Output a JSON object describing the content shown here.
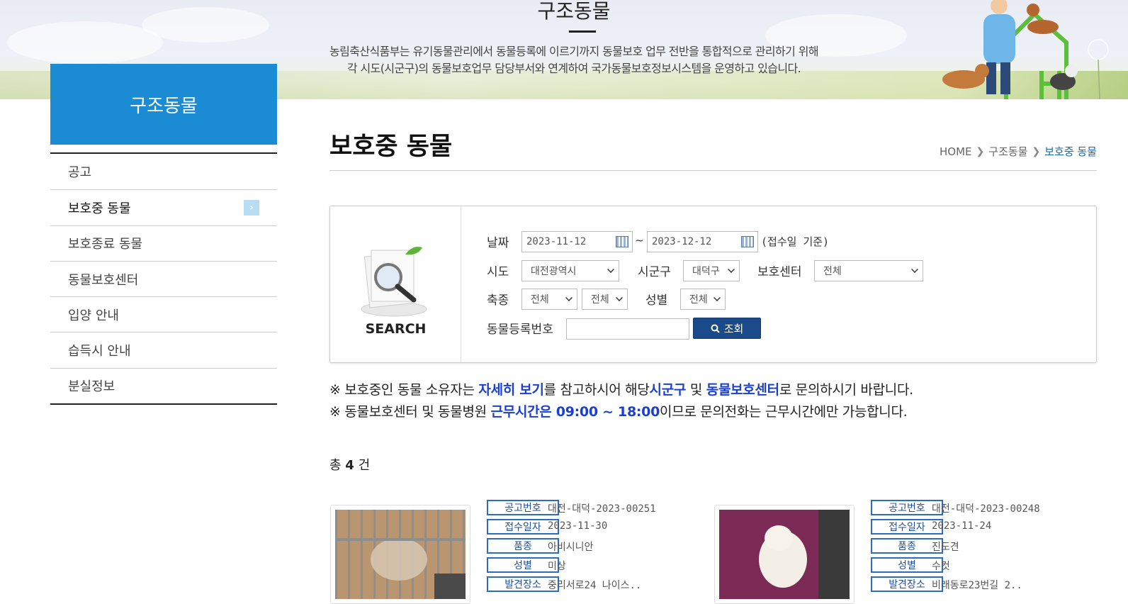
{
  "banner": {
    "title": "구조동물",
    "desc_line1": "농림축산식품부는 유기동물관리에서 동물등록에 이르기까지 동물보호 업무 전반을 통합적으로 관리하기 위해",
    "desc_line2": "각 시도(시군구)의 동물보호업무 담당부서와 연계하여 국가동물보호정보시스템을 운영하고 있습니다."
  },
  "sidebar": {
    "title": "구조동물",
    "items": [
      {
        "label": "공고"
      },
      {
        "label": "보호중 동물"
      },
      {
        "label": "보호종료 동물"
      },
      {
        "label": "동물보호센터"
      },
      {
        "label": "입양 안내"
      },
      {
        "label": "습득시 안내"
      },
      {
        "label": "분실정보"
      }
    ]
  },
  "page": {
    "title": "보호중 동물"
  },
  "breadcrumb": {
    "home": "HOME",
    "level1": "구조동물",
    "current": "보호중 동물"
  },
  "search": {
    "label": "SEARCH",
    "date_label": "날짜",
    "date_from": "2023-11-12",
    "date_to": "2023-12-12",
    "date_sep": "~",
    "date_note": "(접수일 기준)",
    "sido_label": "시도",
    "sido_value": "대전광역시",
    "sigungu_label": "시군구",
    "sigungu_value": "대덕구",
    "center_label": "보호센터",
    "center_value": "전체",
    "species_label": "축종",
    "species_value": "전체",
    "breed_value": "전체",
    "sex_label": "성별",
    "sex_value": "전체",
    "reg_label": "동물등록번호",
    "reg_value": "",
    "button_label": "조회"
  },
  "notice": {
    "mark": "※",
    "line1_a": "보호중인 동물 소유자는 ",
    "line1_hl1": "자세히 보기",
    "line1_b": "를 참고하시어 해당",
    "line1_hl2": "시군구",
    "line1_c": " 및 ",
    "line1_hl3": "동물보호센터",
    "line1_d": "로 문의하시기 바랍니다.",
    "line2_a": "동물보호센터 및 동물병원 ",
    "line2_hl": "근무시간은 09:00 ~ 18:00",
    "line2_b": "이므로 문의전화는 근무시간에만 가능합니다."
  },
  "total": {
    "prefix": "총",
    "count": "4",
    "suffix": "건"
  },
  "field_labels": {
    "notice_no": "공고번호",
    "received": "접수일자",
    "breed": "품종",
    "sex": "성별",
    "found_place": "발견장소"
  },
  "results": [
    {
      "notice_no": "대전-대덕-2023-00251",
      "received": "2023-11-30",
      "breed": "아비시니안",
      "sex": "미상",
      "found_place": "중리서로24 나이스.."
    },
    {
      "notice_no": "대전-대덕-2023-00248",
      "received": "2023-11-24",
      "breed": "진도견",
      "sex": "수컷",
      "found_place": "비래동로23번길 2.."
    }
  ],
  "colors": {
    "accent": "#1b8bd3",
    "button": "#1a4a8a",
    "highlight": "#1a3fd1",
    "tag_border": "#2d6cc0"
  }
}
